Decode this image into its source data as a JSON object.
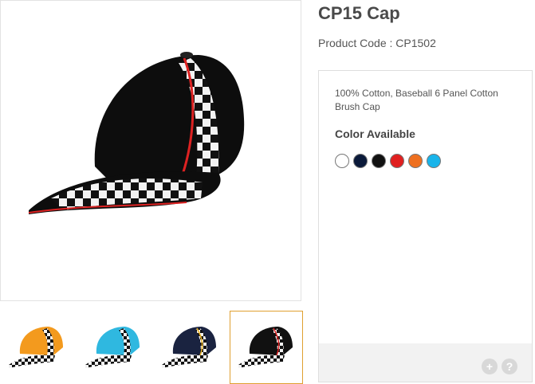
{
  "product": {
    "title": "CP15 Cap",
    "code": "Product Code : CP1502",
    "description": "100% Cotton, Baseball 6 Panel Cotton Brush Cap"
  },
  "gallery": {
    "main_image": "black-racing-cap-image",
    "thumbnails": [
      {
        "name": "orange-cap-thumbnail",
        "color": "#f39a1e"
      },
      {
        "name": "cyan-cap-thumbnail",
        "color": "#2fb8e0"
      },
      {
        "name": "navy-cap-thumbnail",
        "color": "#1a2340"
      },
      {
        "name": "black-cap-thumbnail",
        "color": "#111111",
        "selected": true
      }
    ]
  },
  "colors": {
    "heading": "Color Available",
    "swatches": [
      "#ffffff",
      "#0b1a3a",
      "#111111",
      "#e02020",
      "#ee7020",
      "#19b4ea"
    ]
  },
  "panel_footer": {
    "add_icon": "plus-icon",
    "help_icon": "question-icon",
    "add_label": "+",
    "help_label": "?"
  }
}
